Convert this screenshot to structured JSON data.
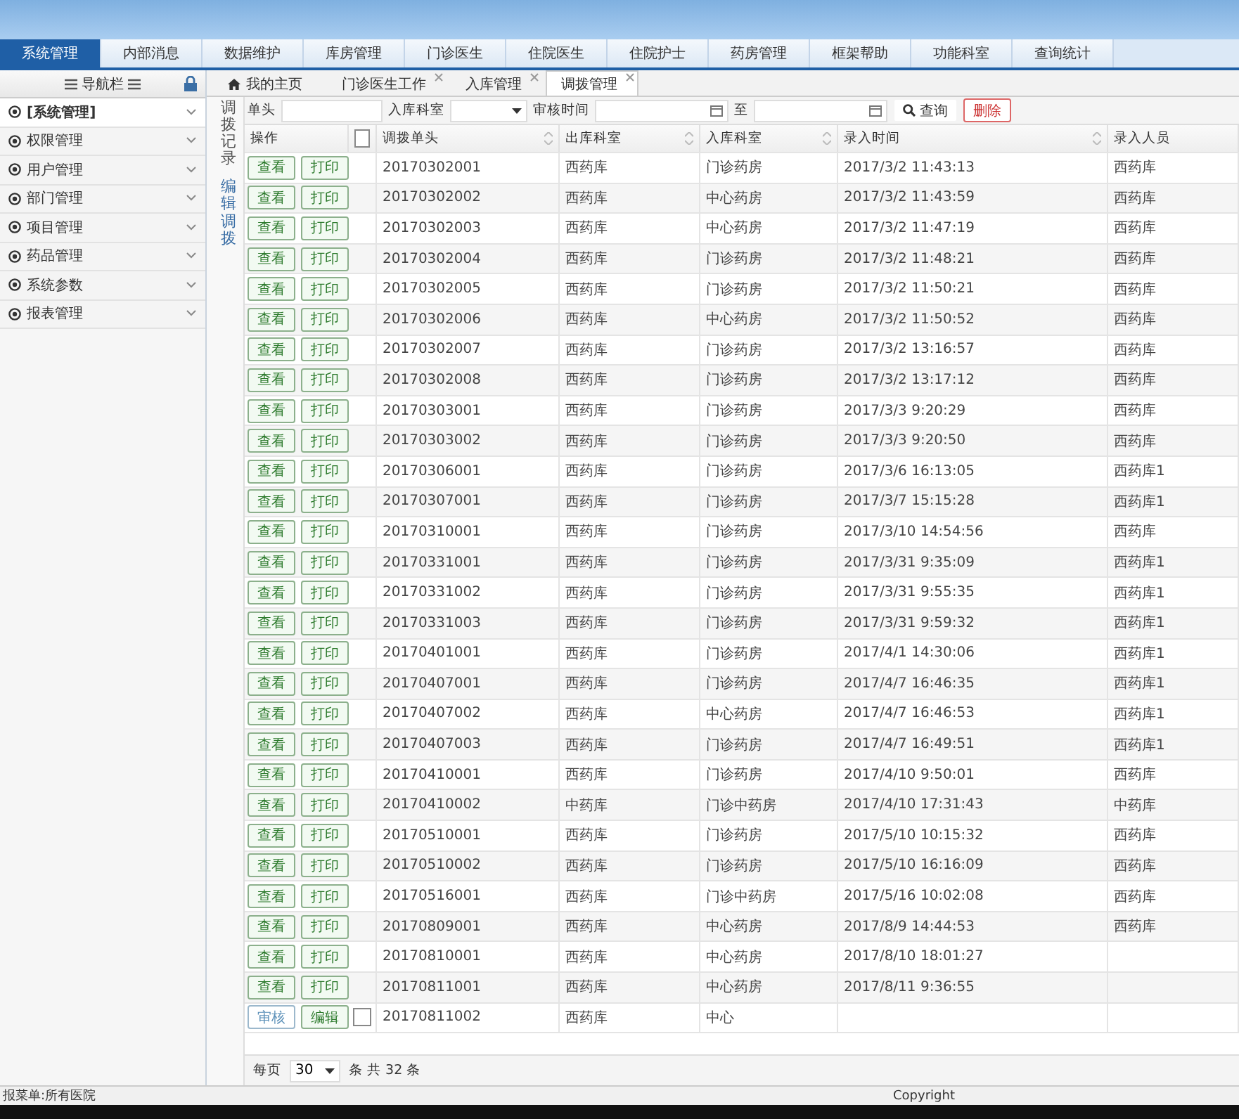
{
  "menu": [
    {
      "label": "系统管理",
      "selected": true
    },
    {
      "label": "内部消息",
      "selected": false
    },
    {
      "label": "数据维护",
      "selected": false
    },
    {
      "label": "库房管理",
      "selected": false
    },
    {
      "label": "门诊医生",
      "selected": false
    },
    {
      "label": "住院医生",
      "selected": false
    },
    {
      "label": "住院护士",
      "selected": false
    },
    {
      "label": "药房管理",
      "selected": false
    },
    {
      "label": "框架帮助",
      "selected": false
    },
    {
      "label": "功能科室",
      "selected": false
    },
    {
      "label": "查询统计",
      "selected": false
    }
  ],
  "sidebar": {
    "title": "导航栏",
    "items": [
      {
        "label": "[系统管理]",
        "selected": true
      },
      {
        "label": "权限管理",
        "selected": false
      },
      {
        "label": "用户管理",
        "selected": false
      },
      {
        "label": "部门管理",
        "selected": false
      },
      {
        "label": "项目管理",
        "selected": false
      },
      {
        "label": "药品管理",
        "selected": false
      },
      {
        "label": "系统参数",
        "selected": false
      },
      {
        "label": "报表管理",
        "selected": false
      }
    ]
  },
  "tabs": [
    {
      "label": "我的主页",
      "kind": "home",
      "selected": false
    },
    {
      "label": "门诊医生工作",
      "kind": "closable",
      "selected": false
    },
    {
      "label": "入库管理",
      "kind": "closable",
      "selected": false
    },
    {
      "label": "调拨管理",
      "kind": "closable",
      "selected": true
    }
  ],
  "side_tabs": [
    {
      "label": "调拨记录",
      "selected": true
    },
    {
      "label": "编辑调拨",
      "selected": false
    }
  ],
  "filters": {
    "doc_label": "单头",
    "dept_label": "入库科室",
    "time_label": "审核时间",
    "to_label": "至",
    "search_button": "查询",
    "delete_button": "删除"
  },
  "table": {
    "ops_header": "操作",
    "select_all_checked": false,
    "columns": [
      "调拨单头",
      "出库科室",
      "入库科室",
      "录入时间",
      "录入人员"
    ],
    "rows": [
      {
        "kind": "done",
        "actions": [
          "查看",
          "打印"
        ],
        "cells": [
          "20170302001",
          "西药库",
          "门诊药房",
          "2017/3/2 11:43:13",
          "西药库"
        ]
      },
      {
        "kind": "done",
        "actions": [
          "查看",
          "打印"
        ],
        "cells": [
          "20170302002",
          "西药库",
          "中心药房",
          "2017/3/2 11:43:59",
          "西药库"
        ]
      },
      {
        "kind": "done",
        "actions": [
          "查看",
          "打印"
        ],
        "cells": [
          "20170302003",
          "西药库",
          "中心药房",
          "2017/3/2 11:47:19",
          "西药库"
        ]
      },
      {
        "kind": "done",
        "actions": [
          "查看",
          "打印"
        ],
        "cells": [
          "20170302004",
          "西药库",
          "门诊药房",
          "2017/3/2 11:48:21",
          "西药库"
        ]
      },
      {
        "kind": "done",
        "actions": [
          "查看",
          "打印"
        ],
        "cells": [
          "20170302005",
          "西药库",
          "门诊药房",
          "2017/3/2 11:50:21",
          "西药库"
        ]
      },
      {
        "kind": "done",
        "actions": [
          "查看",
          "打印"
        ],
        "cells": [
          "20170302006",
          "西药库",
          "中心药房",
          "2017/3/2 11:50:52",
          "西药库"
        ]
      },
      {
        "kind": "done",
        "actions": [
          "查看",
          "打印"
        ],
        "cells": [
          "20170302007",
          "西药库",
          "门诊药房",
          "2017/3/2 13:16:57",
          "西药库"
        ]
      },
      {
        "kind": "done",
        "actions": [
          "查看",
          "打印"
        ],
        "cells": [
          "20170302008",
          "西药库",
          "门诊药房",
          "2017/3/2 13:17:12",
          "西药库"
        ]
      },
      {
        "kind": "done",
        "actions": [
          "查看",
          "打印"
        ],
        "cells": [
          "20170303001",
          "西药库",
          "门诊药房",
          "2017/3/3 9:20:29",
          "西药库"
        ]
      },
      {
        "kind": "done",
        "actions": [
          "查看",
          "打印"
        ],
        "cells": [
          "20170303002",
          "西药库",
          "门诊药房",
          "2017/3/3 9:20:50",
          "西药库"
        ]
      },
      {
        "kind": "done",
        "actions": [
          "查看",
          "打印"
        ],
        "cells": [
          "20170306001",
          "西药库",
          "门诊药房",
          "2017/3/6 16:13:05",
          "西药库1"
        ]
      },
      {
        "kind": "done",
        "actions": [
          "查看",
          "打印"
        ],
        "cells": [
          "20170307001",
          "西药库",
          "门诊药房",
          "2017/3/7 15:15:28",
          "西药库1"
        ]
      },
      {
        "kind": "done",
        "actions": [
          "查看",
          "打印"
        ],
        "cells": [
          "20170310001",
          "西药库",
          "门诊药房",
          "2017/3/10 14:54:56",
          "西药库"
        ]
      },
      {
        "kind": "done",
        "actions": [
          "查看",
          "打印"
        ],
        "cells": [
          "20170331001",
          "西药库",
          "门诊药房",
          "2017/3/31 9:35:09",
          "西药库1"
        ]
      },
      {
        "kind": "done",
        "actions": [
          "查看",
          "打印"
        ],
        "cells": [
          "20170331002",
          "西药库",
          "门诊药房",
          "2017/3/31 9:55:35",
          "西药库1"
        ]
      },
      {
        "kind": "done",
        "actions": [
          "查看",
          "打印"
        ],
        "cells": [
          "20170331003",
          "西药库",
          "门诊药房",
          "2017/3/31 9:59:32",
          "西药库1"
        ]
      },
      {
        "kind": "done",
        "actions": [
          "查看",
          "打印"
        ],
        "cells": [
          "20170401001",
          "西药库",
          "门诊药房",
          "2017/4/1 14:30:06",
          "西药库1"
        ]
      },
      {
        "kind": "done",
        "actions": [
          "查看",
          "打印"
        ],
        "cells": [
          "20170407001",
          "西药库",
          "门诊药房",
          "2017/4/7 16:46:35",
          "西药库1"
        ]
      },
      {
        "kind": "done",
        "actions": [
          "查看",
          "打印"
        ],
        "cells": [
          "20170407002",
          "西药库",
          "中心药房",
          "2017/4/7 16:46:53",
          "西药库1"
        ]
      },
      {
        "kind": "done",
        "actions": [
          "查看",
          "打印"
        ],
        "cells": [
          "20170407003",
          "西药库",
          "门诊药房",
          "2017/4/7 16:49:51",
          "西药库1"
        ]
      },
      {
        "kind": "done",
        "actions": [
          "查看",
          "打印"
        ],
        "cells": [
          "20170410001",
          "西药库",
          "门诊药房",
          "2017/4/10 9:50:01",
          "西药库"
        ]
      },
      {
        "kind": "done",
        "actions": [
          "查看",
          "打印"
        ],
        "cells": [
          "20170410002",
          "中药库",
          "门诊中药房",
          "2017/4/10 17:31:43",
          "中药库"
        ]
      },
      {
        "kind": "done",
        "actions": [
          "查看",
          "打印"
        ],
        "cells": [
          "20170510001",
          "西药库",
          "门诊药房",
          "2017/5/10 10:15:32",
          "西药库"
        ]
      },
      {
        "kind": "done",
        "actions": [
          "查看",
          "打印"
        ],
        "cells": [
          "20170510002",
          "西药库",
          "门诊药房",
          "2017/5/10 16:16:09",
          "西药库"
        ]
      },
      {
        "kind": "done",
        "actions": [
          "查看",
          "打印"
        ],
        "cells": [
          "20170516001",
          "西药库",
          "门诊中药房",
          "2017/5/16 10:02:08",
          "西药库"
        ]
      },
      {
        "kind": "done",
        "actions": [
          "查看",
          "打印"
        ],
        "cells": [
          "20170809001",
          "西药库",
          "中心药房",
          "2017/8/9 14:44:53",
          "西药库"
        ]
      },
      {
        "kind": "done",
        "actions": [
          "查看",
          "打印"
        ],
        "cells": [
          "20170810001",
          "西药库",
          "中心药房",
          "2017/8/10 18:01:27",
          ""
        ]
      },
      {
        "kind": "done",
        "actions": [
          "查看",
          "打印"
        ],
        "cells": [
          "20170811001",
          "西药库",
          "中心药房",
          "2017/8/11 9:36:55",
          ""
        ]
      },
      {
        "kind": "pending",
        "checked": false,
        "actions": [
          "审核",
          "编辑"
        ],
        "cells": [
          "20170811002",
          "西药库",
          "中心",
          "",
          ""
        ]
      }
    ]
  },
  "pager": {
    "per_page_label": "每页",
    "per_page": "30",
    "total": "条 共 32 条"
  },
  "status_bar": {
    "left": "报菜单:所有医院",
    "right": "Copyright"
  }
}
